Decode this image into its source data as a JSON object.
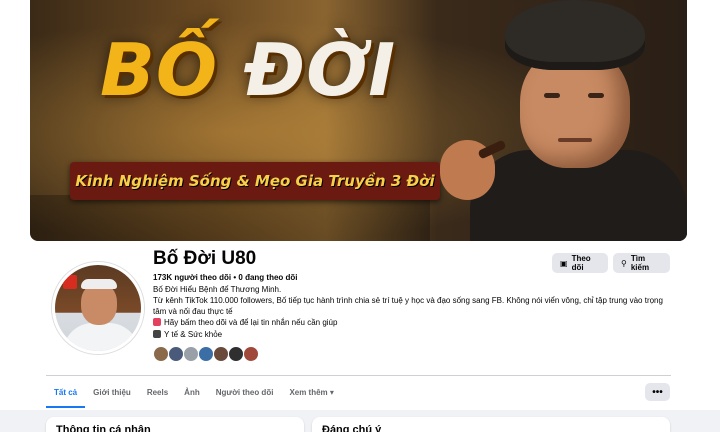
{
  "cover": {
    "title_part1": "BỐ",
    "title_part2": "ĐỜI",
    "banner": "Kinh Nghiệm Sống & Mẹo Gia Truyền 3 Đời"
  },
  "profile": {
    "name": "Bố Đời U80",
    "stats": "173K người theo dõi • 0 đang theo dõi",
    "bio": "Bố Đời Hiểu Bệnh để Thương Minh.",
    "intro_line1": "Từ kênh TikTok 110.000 followers, Bố tiếp tục hành trình chia sẻ trí tuệ y học và đạo sống sang FB. Không nói viển vông, chỉ tập trung vào trọng",
    "intro_line2": "tâm và nối đau thực tế",
    "cta": "Hãy bấm theo dõi và để lại tin nhắn nếu cần giúp",
    "category": "Y tế & Sức khỏe"
  },
  "header_buttons": {
    "follow": "Theo dõi",
    "search": "Tìm kiếm"
  },
  "tabs": [
    {
      "label": "Tất cả",
      "active": true
    },
    {
      "label": "Giới thiệu"
    },
    {
      "label": "Reels"
    },
    {
      "label": "Ảnh"
    },
    {
      "label": "Người theo dõi"
    },
    {
      "label": "Xem thêm ▾"
    }
  ],
  "more_button": "•••",
  "cards": {
    "left_title": "Thông tin cá nhân",
    "right_title": "Đáng chú ý"
  },
  "colors": {
    "accent": "#1877f2",
    "button_bg": "#e4e6eb",
    "page_bg": "#f0f2f5"
  }
}
